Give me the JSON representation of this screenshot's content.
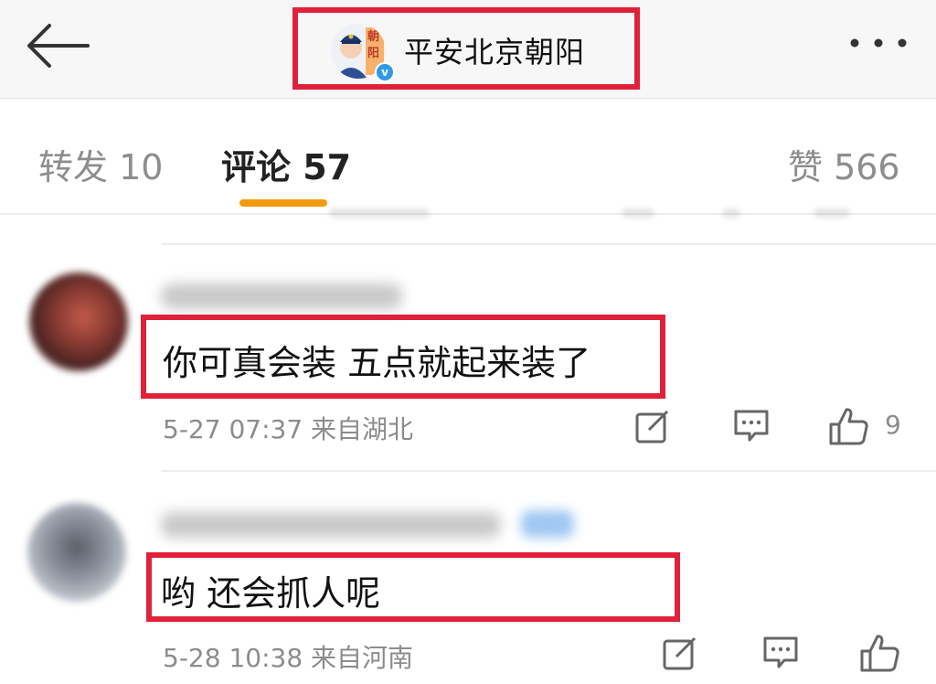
{
  "header": {
    "title": "平安北京朝阳",
    "avatar_glyph": "朝阳",
    "verified_mark": "v",
    "back_icon": "back-arrow-icon",
    "more_icon": "more-dots-icon"
  },
  "tabs": {
    "repost": "转发 10",
    "comments": "评论 57",
    "likes": "赞 566",
    "active_color": "#f29b10"
  },
  "comments": [
    {
      "text": "你可真会装 五点就起来装了",
      "meta": "5-27 07:37 来自湖北",
      "likes": "9"
    },
    {
      "text": "哟 还会抓人呢",
      "meta": "5-28 10:38 来自河南",
      "likes": ""
    }
  ],
  "colors": {
    "highlight": "#e0213a",
    "meta_text": "#8c8c8c",
    "verified": "#2f9be8"
  }
}
